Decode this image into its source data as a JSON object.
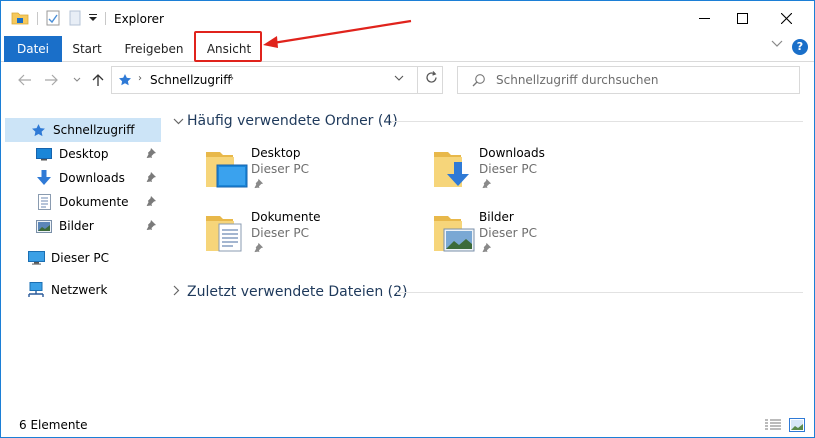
{
  "window": {
    "title": "Explorer",
    "controls": {
      "minimize": "—",
      "maximize": "☐",
      "close": "✕"
    }
  },
  "ribbon": {
    "tabs": [
      {
        "label": "Datei",
        "active": true
      },
      {
        "label": "Start"
      },
      {
        "label": "Freigeben"
      },
      {
        "label": "Ansicht",
        "highlighted": true
      }
    ],
    "help": "?"
  },
  "address_bar": {
    "path": [
      "Schnellzugriff"
    ]
  },
  "search": {
    "placeholder": "Schnellzugriff durchsuchen"
  },
  "sidebar": {
    "items": [
      {
        "label": "Schnellzugriff",
        "icon": "quick-access-star-icon",
        "selected": true
      },
      {
        "label": "Desktop",
        "icon": "desktop-icon",
        "pinned": true
      },
      {
        "label": "Downloads",
        "icon": "download-arrow-icon",
        "pinned": true
      },
      {
        "label": "Dokumente",
        "icon": "documents-icon",
        "pinned": true
      },
      {
        "label": "Bilder",
        "icon": "pictures-icon",
        "pinned": true
      },
      {
        "label": "Dieser PC",
        "icon": "computer-icon"
      },
      {
        "label": "Netzwerk",
        "icon": "network-icon"
      }
    ]
  },
  "main": {
    "frequent_folders": {
      "header": "Häufig verwendete Ordner (4)",
      "expanded": true,
      "items": [
        {
          "name": "Desktop",
          "location": "Dieser PC",
          "icon": "desktop-folder-icon"
        },
        {
          "name": "Downloads",
          "location": "Dieser PC",
          "icon": "downloads-folder-icon"
        },
        {
          "name": "Dokumente",
          "location": "Dieser PC",
          "icon": "documents-folder-icon"
        },
        {
          "name": "Bilder",
          "location": "Dieser PC",
          "icon": "pictures-folder-icon"
        }
      ]
    },
    "recent_files": {
      "header": "Zuletzt verwendete Dateien (2)",
      "expanded": false
    }
  },
  "status_bar": {
    "item_count": "6 Elemente"
  },
  "colors": {
    "accent": "#1a6fc9",
    "window_border": "#1c7fd6",
    "selection": "#cce4f7",
    "annotation_red": "#e0231c",
    "group_header": "#1e395b",
    "folder_yellow": "#f6c95c"
  }
}
